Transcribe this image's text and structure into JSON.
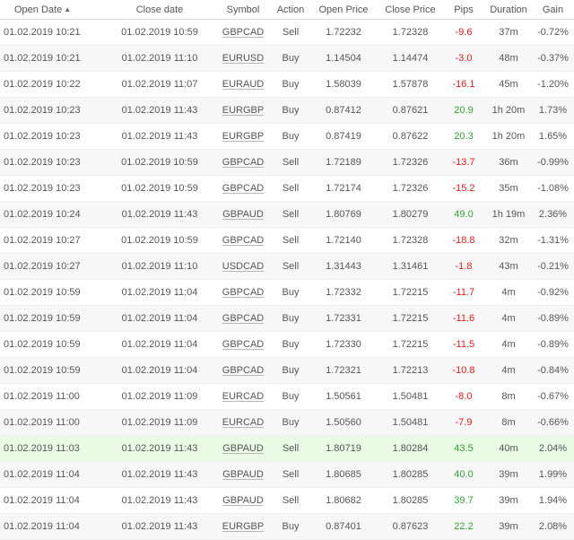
{
  "table": {
    "headers": {
      "open_date": "Open Date",
      "close_date": "Close date",
      "symbol": "Symbol",
      "action": "Action",
      "open_price": "Open Price",
      "close_price": "Close Price",
      "pips": "Pips",
      "duration": "Duration",
      "gain": "Gain"
    },
    "sort": {
      "column": "open_date",
      "direction": "ascending",
      "indicator": "▲"
    },
    "colors": {
      "positive": "#34a234",
      "negative": "#e21b1b",
      "highlight_row": "#e9fbe4"
    },
    "rows": [
      {
        "open_date": "01.02.2019 10:21",
        "close_date": "01.02.2019 10:59",
        "symbol": "GBPCAD",
        "action": "Sell",
        "open_price": "1.72232",
        "close_price": "1.72328",
        "pips": "-9.6",
        "duration": "37m",
        "gain": "-0.72%"
      },
      {
        "open_date": "01.02.2019 10:21",
        "close_date": "01.02.2019 11:10",
        "symbol": "EURUSD",
        "action": "Buy",
        "open_price": "1.14504",
        "close_price": "1.14474",
        "pips": "-3.0",
        "duration": "48m",
        "gain": "-0.37%"
      },
      {
        "open_date": "01.02.2019 10:22",
        "close_date": "01.02.2019 11:07",
        "symbol": "EURAUD",
        "action": "Buy",
        "open_price": "1.58039",
        "close_price": "1.57878",
        "pips": "-16.1",
        "duration": "45m",
        "gain": "-1.20%"
      },
      {
        "open_date": "01.02.2019 10:23",
        "close_date": "01.02.2019 11:43",
        "symbol": "EURGBP",
        "action": "Buy",
        "open_price": "0.87412",
        "close_price": "0.87621",
        "pips": "20.9",
        "duration": "1h 20m",
        "gain": "1.73%"
      },
      {
        "open_date": "01.02.2019 10:23",
        "close_date": "01.02.2019 11:43",
        "symbol": "EURGBP",
        "action": "Buy",
        "open_price": "0.87419",
        "close_price": "0.87622",
        "pips": "20.3",
        "duration": "1h 20m",
        "gain": "1.65%"
      },
      {
        "open_date": "01.02.2019 10:23",
        "close_date": "01.02.2019 10:59",
        "symbol": "GBPCAD",
        "action": "Sell",
        "open_price": "1.72189",
        "close_price": "1.72326",
        "pips": "-13.7",
        "duration": "36m",
        "gain": "-0.99%"
      },
      {
        "open_date": "01.02.2019 10:23",
        "close_date": "01.02.2019 10:59",
        "symbol": "GBPCAD",
        "action": "Sell",
        "open_price": "1.72174",
        "close_price": "1.72326",
        "pips": "-15.2",
        "duration": "35m",
        "gain": "-1.08%"
      },
      {
        "open_date": "01.02.2019 10:24",
        "close_date": "01.02.2019 11:43",
        "symbol": "GBPAUD",
        "action": "Sell",
        "open_price": "1.80769",
        "close_price": "1.80279",
        "pips": "49.0",
        "duration": "1h 19m",
        "gain": "2.36%"
      },
      {
        "open_date": "01.02.2019 10:27",
        "close_date": "01.02.2019 10:59",
        "symbol": "GBPCAD",
        "action": "Sell",
        "open_price": "1.72140",
        "close_price": "1.72328",
        "pips": "-18.8",
        "duration": "32m",
        "gain": "-1.31%"
      },
      {
        "open_date": "01.02.2019 10:27",
        "close_date": "01.02.2019 11:10",
        "symbol": "USDCAD",
        "action": "Sell",
        "open_price": "1.31443",
        "close_price": "1.31461",
        "pips": "-1.8",
        "duration": "43m",
        "gain": "-0.21%"
      },
      {
        "open_date": "01.02.2019 10:59",
        "close_date": "01.02.2019 11:04",
        "symbol": "GBPCAD",
        "action": "Buy",
        "open_price": "1.72332",
        "close_price": "1.72215",
        "pips": "-11.7",
        "duration": "4m",
        "gain": "-0.92%"
      },
      {
        "open_date": "01.02.2019 10:59",
        "close_date": "01.02.2019 11:04",
        "symbol": "GBPCAD",
        "action": "Buy",
        "open_price": "1.72331",
        "close_price": "1.72215",
        "pips": "-11.6",
        "duration": "4m",
        "gain": "-0.89%"
      },
      {
        "open_date": "01.02.2019 10:59",
        "close_date": "01.02.2019 11:04",
        "symbol": "GBPCAD",
        "action": "Buy",
        "open_price": "1.72330",
        "close_price": "1.72215",
        "pips": "-11.5",
        "duration": "4m",
        "gain": "-0.89%"
      },
      {
        "open_date": "01.02.2019 10:59",
        "close_date": "01.02.2019 11:04",
        "symbol": "GBPCAD",
        "action": "Buy",
        "open_price": "1.72321",
        "close_price": "1.72213",
        "pips": "-10.8",
        "duration": "4m",
        "gain": "-0.84%"
      },
      {
        "open_date": "01.02.2019 11:00",
        "close_date": "01.02.2019 11:09",
        "symbol": "EURCAD",
        "action": "Buy",
        "open_price": "1.50561",
        "close_price": "1.50481",
        "pips": "-8.0",
        "duration": "8m",
        "gain": "-0.67%"
      },
      {
        "open_date": "01.02.2019 11:00",
        "close_date": "01.02.2019 11:09",
        "symbol": "EURCAD",
        "action": "Buy",
        "open_price": "1.50560",
        "close_price": "1.50481",
        "pips": "-7.9",
        "duration": "8m",
        "gain": "-0.66%"
      },
      {
        "open_date": "01.02.2019 11:03",
        "close_date": "01.02.2019 11:43",
        "symbol": "GBPAUD",
        "action": "Sell",
        "open_price": "1.80719",
        "close_price": "1.80284",
        "pips": "43.5",
        "duration": "40m",
        "gain": "2.04%",
        "highlighted": true
      },
      {
        "open_date": "01.02.2019 11:04",
        "close_date": "01.02.2019 11:43",
        "symbol": "GBPAUD",
        "action": "Sell",
        "open_price": "1.80685",
        "close_price": "1.80285",
        "pips": "40.0",
        "duration": "39m",
        "gain": "1.99%"
      },
      {
        "open_date": "01.02.2019 11:04",
        "close_date": "01.02.2019 11:43",
        "symbol": "GBPAUD",
        "action": "Sell",
        "open_price": "1.80682",
        "close_price": "1.80285",
        "pips": "39.7",
        "duration": "39m",
        "gain": "1.94%"
      },
      {
        "open_date": "01.02.2019 11:04",
        "close_date": "01.02.2019 11:43",
        "symbol": "EURGBP",
        "action": "Buy",
        "open_price": "0.87401",
        "close_price": "0.87623",
        "pips": "22.2",
        "duration": "39m",
        "gain": "2.08%"
      }
    ]
  }
}
